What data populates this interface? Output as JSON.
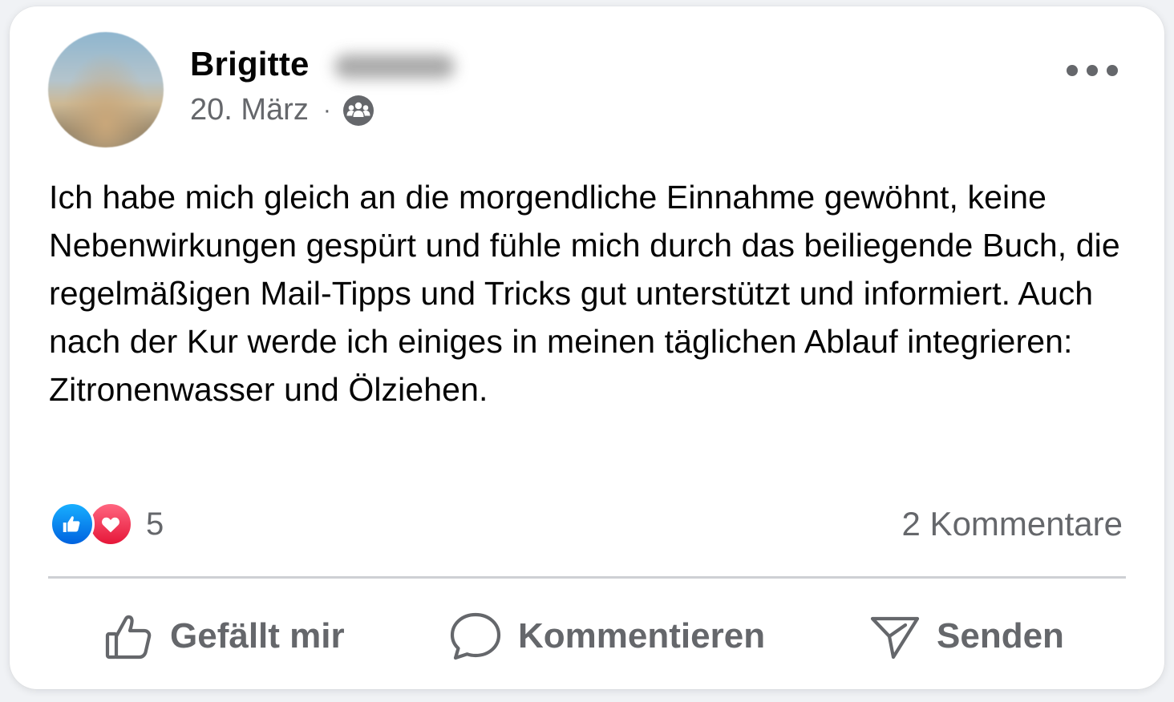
{
  "post": {
    "author_first_name": "Brigitte",
    "date": "20. März",
    "separator": "·",
    "audience_icon": "group-icon",
    "text": "Ich habe mich gleich an die morgendliche Einnahme gewöhnt, keine Nebenwirkungen gespürt und fühle mich durch das beiliegende Buch, die regelmäßigen Mail-Tipps und Tricks gut unterstützt und informiert. Auch nach der Kur werde ich einiges in meinen täglichen Ablauf integrieren: Zitronenwasser und Ölziehen."
  },
  "reactions": {
    "types": [
      "like",
      "love"
    ],
    "count": "5",
    "colors": {
      "like": "#1877f2",
      "love": "#f33e58"
    }
  },
  "comments": {
    "label": "2 Kommentare"
  },
  "actions": {
    "like_label": "Gefällt mir",
    "comment_label": "Kommentieren",
    "send_label": "Senden"
  },
  "colors": {
    "text_primary": "#050505",
    "text_secondary": "#65676b",
    "divider": "#ced0d4"
  }
}
